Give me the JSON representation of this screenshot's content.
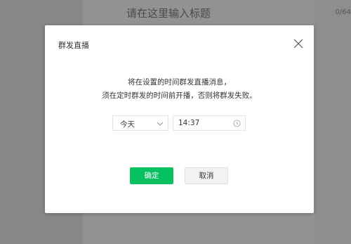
{
  "background": {
    "title_placeholder": "请在这里输入标题",
    "title_counter": "0/64"
  },
  "dialog": {
    "title": "群发直播",
    "close_icon": "close-icon",
    "message_line1": "将在设置的时间群发直播消息，",
    "message_line2": "须在定时群发的时间前开播，否则将群发失败。",
    "day_select": {
      "value": "今天",
      "icon": "chevron-down-icon"
    },
    "time_input": {
      "value": "14:37",
      "icon": "clock-icon"
    },
    "confirm_label": "确定",
    "cancel_label": "取消"
  },
  "colors": {
    "accent": "#07c160",
    "overlay": "#8f8f8f"
  }
}
